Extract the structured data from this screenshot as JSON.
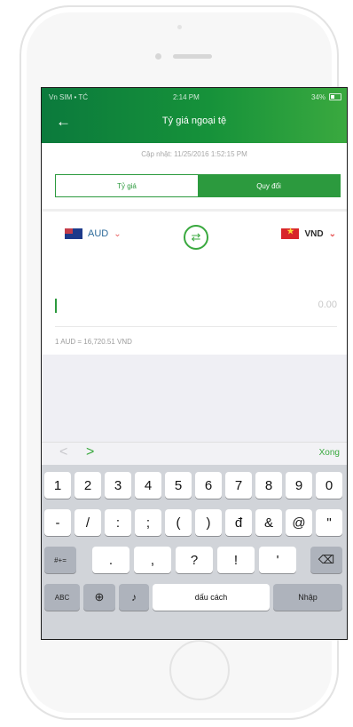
{
  "status_bar": {
    "carrier": "Vn SIM • TĆ",
    "time": "2:14 PM",
    "battery": "34%"
  },
  "header": {
    "title": "Tỷ giá ngoại tệ"
  },
  "updated": "Cập nhật: 11/25/2016 1:52:15 PM",
  "tabs": [
    {
      "label": "Tỷ giá",
      "active": false
    },
    {
      "label": "Quy đổi",
      "active": true
    }
  ],
  "converter": {
    "from_currency": "AUD",
    "to_currency": "VND",
    "amount_placeholder": "0.00",
    "rate_text": "1 AUD = 16,720.51 VND"
  },
  "accessory": {
    "prev": "<",
    "next": ">",
    "done": "Xong"
  },
  "keyboard": {
    "row1": [
      "1",
      "2",
      "3",
      "4",
      "5",
      "6",
      "7",
      "8",
      "9",
      "0"
    ],
    "row2": [
      "-",
      "/",
      ":",
      ";",
      "(",
      ")",
      "đ",
      "&",
      "@",
      "\""
    ],
    "row3": {
      "more": "#+=",
      "keys": [
        ".",
        ",",
        "?",
        "!",
        "'"
      ],
      "delete": "⌫"
    },
    "row4": {
      "abc": "ABC",
      "globe": "⊕",
      "mic": "♪",
      "space": "dấu cách",
      "return": "Nhập"
    }
  },
  "colors": {
    "accent": "#2c9a3e",
    "header_dark": "#0b7a3c",
    "header_light": "#3aa93f"
  },
  "icons": {
    "back": "arrow-left-icon",
    "swap": "swap-icon",
    "delete": "backspace-icon"
  }
}
